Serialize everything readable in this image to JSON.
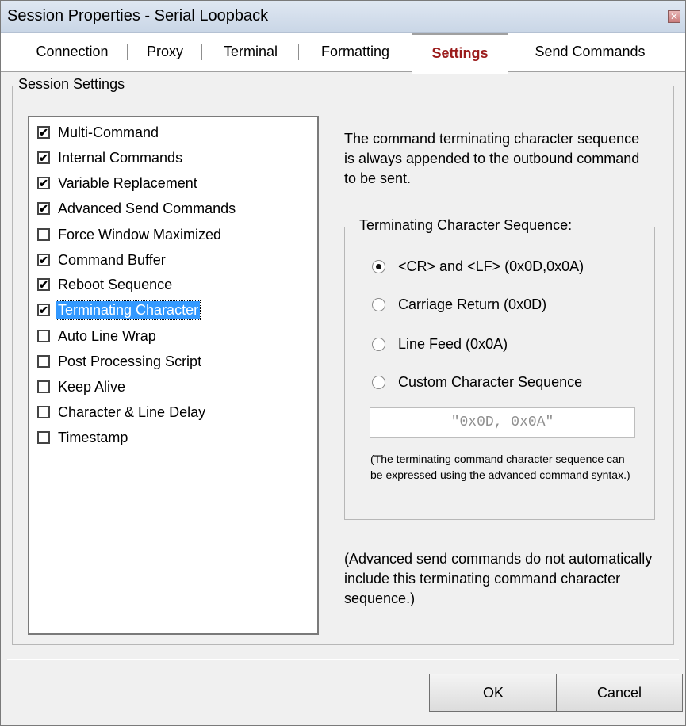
{
  "window": {
    "title": "Session Properties - Serial Loopback",
    "close_glyph": "✕"
  },
  "tabs": [
    {
      "label": "Connection",
      "active": false
    },
    {
      "label": "Proxy",
      "active": false
    },
    {
      "label": "Terminal",
      "active": false
    },
    {
      "label": "Formatting",
      "active": false
    },
    {
      "label": "Settings",
      "active": true
    },
    {
      "label": "Send Commands",
      "active": false
    }
  ],
  "session_settings": {
    "group_title": "Session Settings",
    "items": [
      {
        "label": "Multi-Command",
        "checked": true,
        "mark": "✔"
      },
      {
        "label": "Internal Commands",
        "checked": true,
        "mark": "✔"
      },
      {
        "label": "Variable Replacement",
        "checked": true,
        "mark": "✔"
      },
      {
        "label": "Advanced Send Commands",
        "checked": true,
        "mark": "✔"
      },
      {
        "label": "Force Window Maximized",
        "checked": false,
        "mark": ""
      },
      {
        "label": "Command Buffer",
        "checked": true,
        "mark": "✔"
      },
      {
        "label": "Reboot Sequence",
        "checked": true,
        "mark": "✔"
      },
      {
        "label": "Terminating Character",
        "checked": true,
        "mark": "✔",
        "selected": true
      },
      {
        "label": "Auto Line Wrap",
        "checked": false,
        "mark": ""
      },
      {
        "label": "Post Processing Script",
        "checked": false,
        "mark": ""
      },
      {
        "label": "Keep Alive",
        "checked": false,
        "mark": ""
      },
      {
        "label": "Character & Line Delay",
        "checked": false,
        "mark": ""
      },
      {
        "label": "Timestamp",
        "checked": false,
        "mark": ""
      }
    ]
  },
  "detail": {
    "description": "The command terminating character sequence is always appended to the outbound command to be sent.",
    "terminating_group_title": "Terminating Character Sequence:",
    "options": [
      {
        "label": "<CR> and <LF> (0x0D,0x0A)",
        "selected": true
      },
      {
        "label": "Carriage Return (0x0D)",
        "selected": false
      },
      {
        "label": "Line Feed (0x0A)",
        "selected": false
      },
      {
        "label": "Custom Character Sequence",
        "selected": false
      }
    ],
    "custom_sequence_value": "\"0x0D, 0x0A\"",
    "hint": "(The terminating command character sequence can be expressed using the advanced command syntax.)",
    "note": "(Advanced send commands do not automatically include this terminating command character sequence.)"
  },
  "buttons": {
    "ok_label": "OK",
    "cancel_label": "Cancel"
  }
}
